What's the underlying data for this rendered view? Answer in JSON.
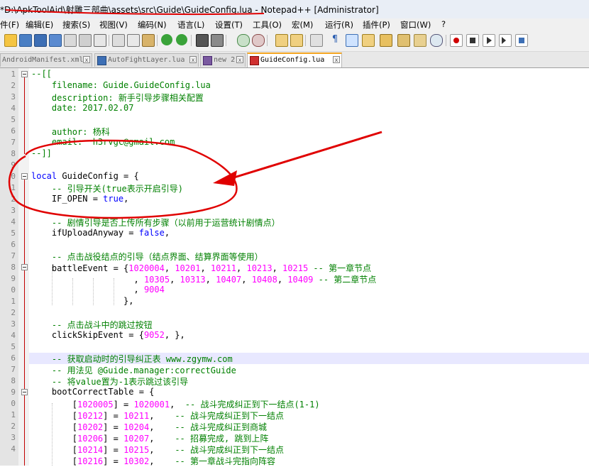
{
  "window": {
    "title": "*D:\\ApkToolAid\\射雕三部曲\\assets\\src\\Guide\\GuideConfig.lua - Notepad++ [Administrator]"
  },
  "menu": [
    "件(F)",
    "编辑(E)",
    "搜索(S)",
    "视图(V)",
    "编码(N)",
    "语言(L)",
    "设置(T)",
    "工具(O)",
    "宏(M)",
    "运行(R)",
    "插件(P)",
    "窗口(W)",
    "?"
  ],
  "tabs": [
    {
      "label": "AndroidManifest.xml",
      "close": "x",
      "active": false
    },
    {
      "label": "AutoFightLayer.lua",
      "close": "x",
      "active": false
    },
    {
      "label": "new 2",
      "close": "x",
      "active": false
    },
    {
      "label": "GuideConfig.lua",
      "close": "x",
      "active": true
    }
  ],
  "editor": {
    "line_numbers": [
      "1",
      "2",
      "3",
      "4",
      "5",
      "6",
      "7",
      "8",
      "9",
      "0",
      "1",
      "2",
      "3",
      "4",
      "5",
      "6",
      "7",
      "8",
      "9",
      "0",
      "1",
      "2",
      "3",
      "4",
      "5",
      "6",
      "7",
      "8",
      "9",
      "0",
      "1",
      "2",
      "3",
      "4"
    ],
    "lines": [
      {
        "t": [
          {
            "c": "cm",
            "s": "--[["
          }
        ]
      },
      {
        "t": [
          {
            "c": "cm",
            "s": "    filename: Guide.GuideConfig.lua"
          }
        ]
      },
      {
        "t": [
          {
            "c": "cm",
            "s": "    description: 新手引导步骤相关配置"
          }
        ]
      },
      {
        "t": [
          {
            "c": "cm",
            "s": "    date: 2017.02.07"
          }
        ]
      },
      {
        "t": []
      },
      {
        "t": [
          {
            "c": "cm",
            "s": "    author: 杨科"
          }
        ]
      },
      {
        "t": [
          {
            "c": "cm",
            "s": "    email:  h3rvgc@gmail.com"
          }
        ]
      },
      {
        "t": [
          {
            "c": "cm",
            "s": "--]]"
          }
        ]
      },
      {
        "t": []
      },
      {
        "t": [
          {
            "c": "kw",
            "s": "local"
          },
          {
            "c": "id",
            "s": " GuideConfig = {"
          }
        ]
      },
      {
        "t": [
          {
            "c": "cm",
            "s": "    -- 引导开关(true表示开启引导)"
          }
        ]
      },
      {
        "t": [
          {
            "c": "id",
            "s": "    IF_OPEN = "
          },
          {
            "c": "kw",
            "s": "true"
          },
          {
            "c": "id",
            "s": ","
          }
        ]
      },
      {
        "t": []
      },
      {
        "t": [
          {
            "c": "cm",
            "s": "    -- 剧情引导是否上传所有步骤（以前用于运营统计剧情点）"
          }
        ]
      },
      {
        "t": [
          {
            "c": "id",
            "s": "    ifUploadAnyway = "
          },
          {
            "c": "kw",
            "s": "false"
          },
          {
            "c": "id",
            "s": ","
          }
        ]
      },
      {
        "t": []
      },
      {
        "t": [
          {
            "c": "cm",
            "s": "    -- 点击战役结点的引导（结点界面、结算界面等使用）"
          }
        ]
      },
      {
        "t": [
          {
            "c": "id",
            "s": "    battleEvent = {"
          },
          {
            "c": "num",
            "s": "1020004"
          },
          {
            "c": "id",
            "s": ", "
          },
          {
            "c": "num",
            "s": "10201"
          },
          {
            "c": "id",
            "s": ", "
          },
          {
            "c": "num",
            "s": "10211"
          },
          {
            "c": "id",
            "s": ", "
          },
          {
            "c": "num",
            "s": "10213"
          },
          {
            "c": "id",
            "s": ", "
          },
          {
            "c": "num",
            "s": "10215"
          },
          {
            "c": "cm",
            "s": " -- 第一章节点"
          }
        ]
      },
      {
        "t": [
          {
            "c": "id",
            "s": "                    , "
          },
          {
            "c": "num",
            "s": "10305"
          },
          {
            "c": "id",
            "s": ", "
          },
          {
            "c": "num",
            "s": "10313"
          },
          {
            "c": "id",
            "s": ", "
          },
          {
            "c": "num",
            "s": "10407"
          },
          {
            "c": "id",
            "s": ", "
          },
          {
            "c": "num",
            "s": "10408"
          },
          {
            "c": "id",
            "s": ", "
          },
          {
            "c": "num",
            "s": "10409"
          },
          {
            "c": "cm",
            "s": " -- 第二章节点"
          }
        ]
      },
      {
        "t": [
          {
            "c": "id",
            "s": "                    , "
          },
          {
            "c": "num",
            "s": "9004"
          }
        ]
      },
      {
        "t": [
          {
            "c": "id",
            "s": "                  },"
          }
        ]
      },
      {
        "t": []
      },
      {
        "t": [
          {
            "c": "cm",
            "s": "    -- 点击战斗中的跳过按钮"
          }
        ]
      },
      {
        "t": [
          {
            "c": "id",
            "s": "    clickSkipEvent = {"
          },
          {
            "c": "num",
            "s": "9052"
          },
          {
            "c": "id",
            "s": ", },"
          }
        ]
      },
      {
        "t": []
      },
      {
        "t": [
          {
            "c": "cm",
            "s": "    -- 获取启动时的引导纠正表 www.zgymw.com"
          }
        ]
      },
      {
        "t": [
          {
            "c": "cm",
            "s": "    -- 用法见 @Guide.manager:correctGuide"
          }
        ]
      },
      {
        "t": [
          {
            "c": "cm",
            "s": "    -- 将value置为-1表示跳过该引导"
          }
        ]
      },
      {
        "t": [
          {
            "c": "id",
            "s": "    bootCorrectTable = {"
          }
        ]
      },
      {
        "t": [
          {
            "c": "id",
            "s": "        ["
          },
          {
            "c": "num",
            "s": "1020005"
          },
          {
            "c": "id",
            "s": "] = "
          },
          {
            "c": "num",
            "s": "1020001"
          },
          {
            "c": "id",
            "s": ",  "
          },
          {
            "c": "cm",
            "s": "-- 战斗完成纠正到下一结点(1-1)"
          }
        ]
      },
      {
        "t": [
          {
            "c": "id",
            "s": "        ["
          },
          {
            "c": "num",
            "s": "10212"
          },
          {
            "c": "id",
            "s": "] = "
          },
          {
            "c": "num",
            "s": "10211"
          },
          {
            "c": "id",
            "s": ",    "
          },
          {
            "c": "cm",
            "s": "-- 战斗完成纠正到下一结点"
          }
        ]
      },
      {
        "t": [
          {
            "c": "id",
            "s": "        ["
          },
          {
            "c": "num",
            "s": "10202"
          },
          {
            "c": "id",
            "s": "] = "
          },
          {
            "c": "num",
            "s": "10204"
          },
          {
            "c": "id",
            "s": ",    "
          },
          {
            "c": "cm",
            "s": "-- 战斗完成纠正到商城"
          }
        ]
      },
      {
        "t": [
          {
            "c": "id",
            "s": "        ["
          },
          {
            "c": "num",
            "s": "10206"
          },
          {
            "c": "id",
            "s": "] = "
          },
          {
            "c": "num",
            "s": "10207"
          },
          {
            "c": "id",
            "s": ",    "
          },
          {
            "c": "cm",
            "s": "-- 招募完成, 跳到上阵"
          }
        ]
      },
      {
        "t": [
          {
            "c": "id",
            "s": "        ["
          },
          {
            "c": "num",
            "s": "10214"
          },
          {
            "c": "id",
            "s": "] = "
          },
          {
            "c": "num",
            "s": "10215"
          },
          {
            "c": "id",
            "s": ",    "
          },
          {
            "c": "cm",
            "s": "-- 战斗完成纠正到下一结点"
          }
        ]
      },
      {
        "t": [
          {
            "c": "id",
            "s": "        ["
          },
          {
            "c": "num",
            "s": "10216"
          },
          {
            "c": "id",
            "s": "] = "
          },
          {
            "c": "num",
            "s": "10302"
          },
          {
            "c": "id",
            "s": ",    "
          },
          {
            "c": "cm",
            "s": "-- 第一章战斗完指向阵容"
          }
        ]
      }
    ]
  },
  "colors": {
    "comment": "#008000",
    "keyword": "#0000ff",
    "number": "#ff00ff",
    "annotation": "#e00000",
    "active_tab_accent": "#f5a623"
  },
  "icons": [
    "new-file-icon",
    "open-icon",
    "save-icon",
    "save-all-icon",
    "close-icon",
    "close-all-icon",
    "print-icon",
    "cut-icon",
    "copy-icon",
    "paste-icon",
    "undo-icon",
    "redo-icon",
    "find-icon",
    "replace-icon",
    "zoom-in-icon",
    "zoom-out-icon",
    "sync-v-icon",
    "sync-h-icon",
    "wrap-icon",
    "all-chars-icon",
    "indent-guide-icon",
    "udl-icon",
    "doc-map-icon",
    "func-list-icon",
    "folder-icon",
    "monitor-icon",
    "record-icon",
    "stop-icon",
    "play-icon",
    "play-multi-icon",
    "save-macro-icon"
  ]
}
